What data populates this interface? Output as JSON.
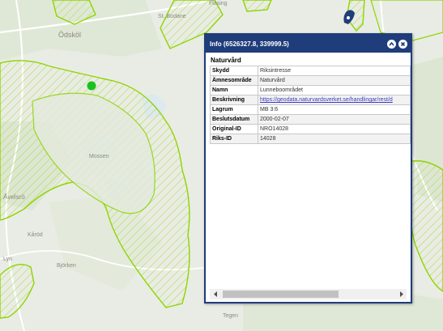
{
  "map": {
    "place_labels": [
      "Ödsköl",
      "St. Bodane",
      "Fläsing",
      "Mossen",
      "Ävelsrö",
      "Kåröd",
      "Björken",
      "Tegen",
      "Lyn"
    ]
  },
  "popup": {
    "title": "Info (6526327.8, 339999.5)",
    "section_title": "Naturvård",
    "rows": [
      {
        "key": "Skydd",
        "value": "Riksintresse"
      },
      {
        "key": "Ämnesområde",
        "value": "Naturvård"
      },
      {
        "key": "Namn",
        "value": "Lunneboområdet"
      },
      {
        "key": "Beskrivning",
        "value": "https://geodata.naturvardsverket.se/handlingar/rest/d"
      },
      {
        "key": "Lagrum",
        "value": "MB 3:6"
      },
      {
        "key": "Beslutsdatum",
        "value": "2000-02-07"
      },
      {
        "key": "Original-ID",
        "value": "NRO14028"
      },
      {
        "key": "Riks-ID",
        "value": "14028"
      }
    ],
    "scroll_position": 0.0
  },
  "colors": {
    "header": "#1f3d7a",
    "polygon_outline": "#8fd400",
    "marker": "#19c21e"
  },
  "icons": [
    "collapse-icon",
    "close-icon",
    "map-marker-icon",
    "scroll-left-icon",
    "scroll-right-icon"
  ]
}
